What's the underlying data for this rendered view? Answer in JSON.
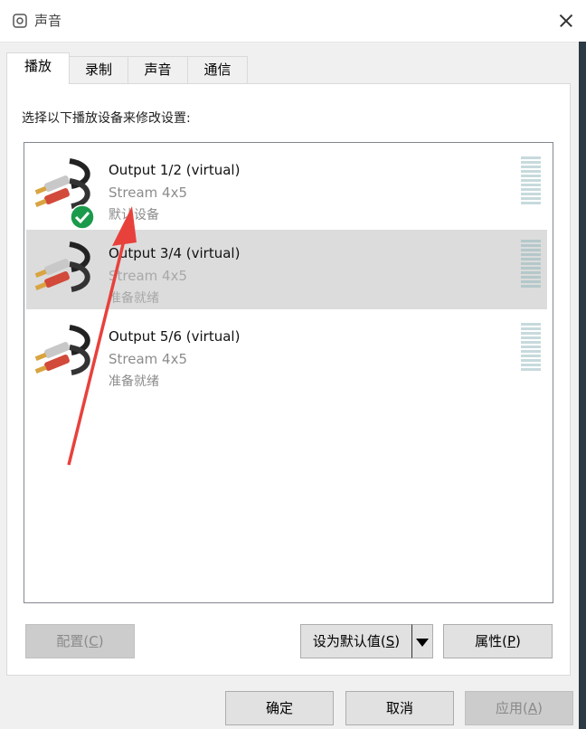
{
  "window": {
    "title": "声音",
    "icon": "speaker-icon"
  },
  "tabs": [
    {
      "label": "播放",
      "active": true
    },
    {
      "label": "录制"
    },
    {
      "label": "声音"
    },
    {
      "label": "通信"
    }
  ],
  "instruction": "选择以下播放设备来修改设置:",
  "devices": [
    {
      "name": "Output 1/2 (virtual)",
      "detail": "Stream 4x5",
      "status": "默认设备",
      "default": true,
      "icon": "rca-cable-icon"
    },
    {
      "name": "Output 3/4 (virtual)",
      "detail": "Stream 4x5",
      "status": "准备就绪",
      "selected": true,
      "icon": "rca-cable-icon"
    },
    {
      "name": "Output 5/6 (virtual)",
      "detail": "Stream 4x5",
      "status": "准备就绪",
      "icon": "rca-cable-icon"
    }
  ],
  "buttons": {
    "configure": {
      "text": "配置(",
      "key": "C",
      "suffix": ")"
    },
    "set_default": {
      "text": "设为默认值(",
      "key": "S",
      "suffix": ")"
    },
    "properties": {
      "text": "属性(",
      "key": "P",
      "suffix": ")"
    },
    "ok": "确定",
    "cancel": "取消",
    "apply": {
      "text": "应用(",
      "key": "A",
      "suffix": ")"
    }
  },
  "colors": {
    "selected_row": "#dcdcdc",
    "default_check": "#1a9b4b",
    "annotation_arrow": "#e8413c"
  }
}
